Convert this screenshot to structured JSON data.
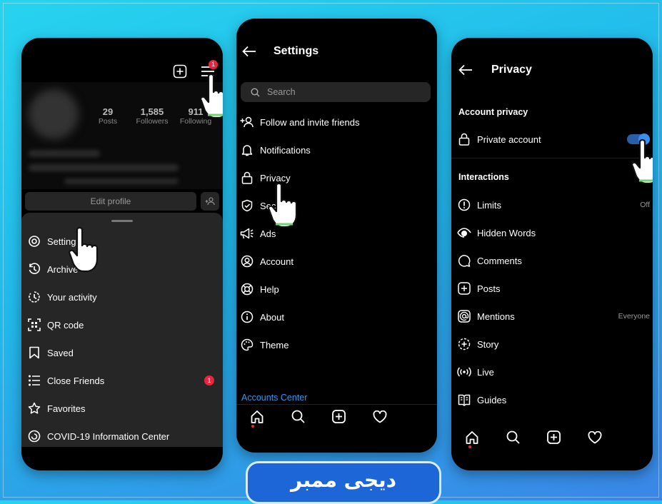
{
  "profile": {
    "stats": [
      {
        "value": "29",
        "label": "Posts"
      },
      {
        "value": "1,585",
        "label": "Followers"
      },
      {
        "value": "911",
        "label": "Following"
      }
    ],
    "menu_badge": "1",
    "edit_profile": "Edit profile",
    "menu": [
      {
        "label": "Settings",
        "icon": "settings-icon"
      },
      {
        "label": "Archive",
        "icon": "archive-icon"
      },
      {
        "label": "Your activity",
        "icon": "activity-icon"
      },
      {
        "label": "QR code",
        "icon": "qr-code-icon"
      },
      {
        "label": "Saved",
        "icon": "bookmark-icon"
      },
      {
        "label": "Close Friends",
        "icon": "close-friends-icon",
        "badge": "1"
      },
      {
        "label": "Favorites",
        "icon": "star-icon"
      },
      {
        "label": "COVID-19 Information Center",
        "icon": "covid-info-icon"
      }
    ]
  },
  "settings": {
    "title": "Settings",
    "search_placeholder": "Search",
    "items": [
      {
        "label": "Follow and invite friends",
        "icon": "add-person-icon"
      },
      {
        "label": "Notifications",
        "icon": "bell-icon"
      },
      {
        "label": "Privacy",
        "icon": "lock-icon"
      },
      {
        "label": "Security",
        "icon": "shield-icon"
      },
      {
        "label": "Ads",
        "icon": "megaphone-icon"
      },
      {
        "label": "Account",
        "icon": "account-icon"
      },
      {
        "label": "Help",
        "icon": "help-icon"
      },
      {
        "label": "About",
        "icon": "info-icon"
      },
      {
        "label": "Theme",
        "icon": "palette-icon"
      }
    ],
    "accounts_center": "Accounts Center"
  },
  "privacy": {
    "title": "Privacy",
    "section_account": "Account privacy",
    "private_account": "Private account",
    "private_enabled": true,
    "section_interactions": "Interactions",
    "items": [
      {
        "label": "Limits",
        "value": "Off",
        "icon": "limits-icon"
      },
      {
        "label": "Hidden Words",
        "value": "",
        "icon": "hidden-words-icon"
      },
      {
        "label": "Comments",
        "value": "",
        "icon": "comment-icon"
      },
      {
        "label": "Posts",
        "value": "",
        "icon": "posts-icon"
      },
      {
        "label": "Mentions",
        "value": "Everyone",
        "icon": "mention-icon"
      },
      {
        "label": "Story",
        "value": "",
        "icon": "story-icon"
      },
      {
        "label": "Live",
        "value": "",
        "icon": "live-icon"
      },
      {
        "label": "Guides",
        "value": "",
        "icon": "guides-icon"
      }
    ]
  },
  "brand": {
    "text": "دیجی ممبر"
  },
  "colors": {
    "accent": "#3a8ef0",
    "badge": "#e8253d",
    "link": "#3797f0"
  }
}
